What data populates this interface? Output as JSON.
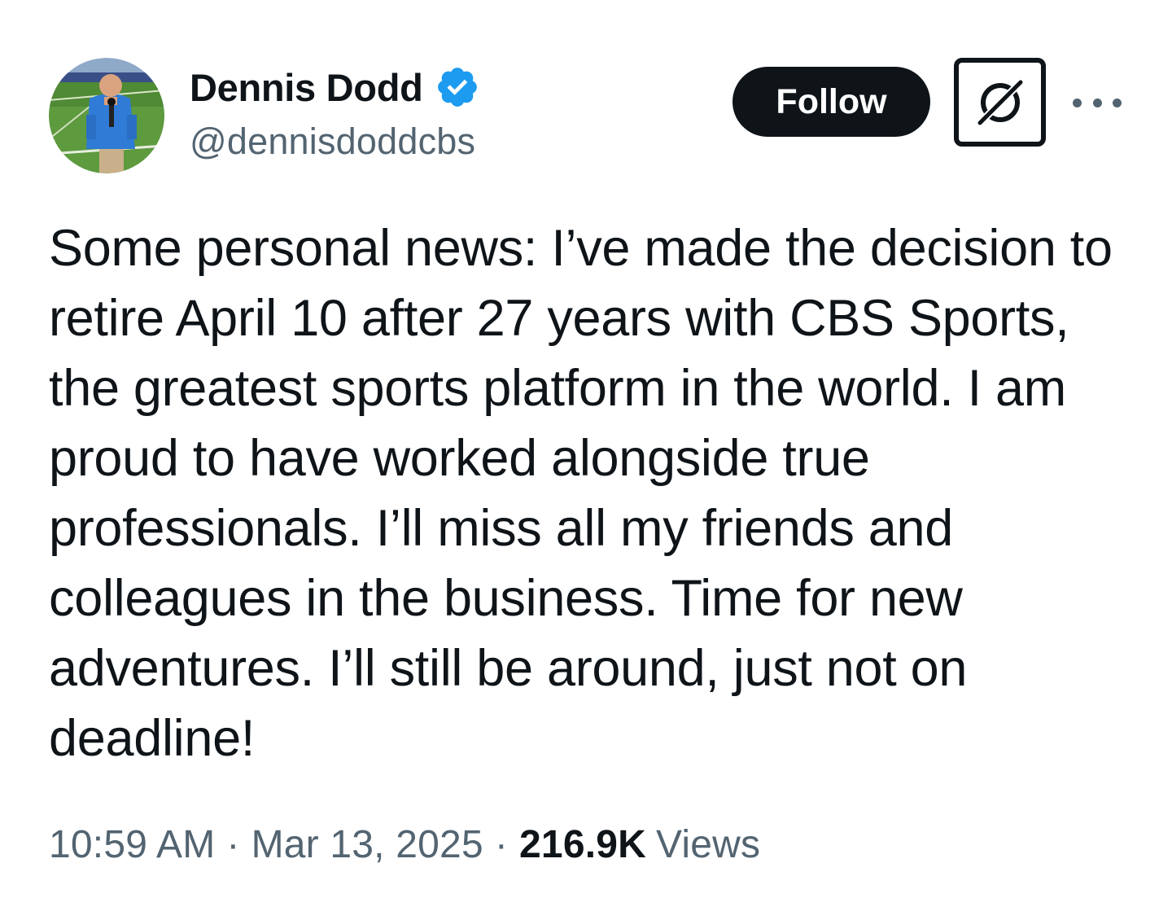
{
  "author": {
    "display_name": "Dennis Dodd",
    "handle": "@dennisdoddcbs",
    "verified_icon": "verified-badge-icon",
    "verified_color": "#1d9bf0"
  },
  "actions": {
    "follow_label": "Follow",
    "grok_icon": "grok-icon",
    "more_icon": "more-horizontal-icon"
  },
  "tweet": {
    "lines": [
      "Some personal news: I’ve made the decision to",
      "retire April 10 after 27 years with CBS Sports,",
      "the greatest sports platform in the world. I am",
      "proud to have worked alongside true",
      "professionals. I’ll miss all my friends and",
      "colleagues in the business. Time for new",
      "adventures. I’ll still be around, just not on",
      "deadline!"
    ]
  },
  "meta": {
    "time": "10:59 AM",
    "separator": "·",
    "date": "Mar 13, 2025",
    "views_count": "216.9K",
    "views_label": "Views"
  },
  "colors": {
    "text_primary": "#0f1419",
    "text_secondary": "#536471",
    "follow_bg": "#0f1419",
    "follow_text": "#ffffff"
  }
}
